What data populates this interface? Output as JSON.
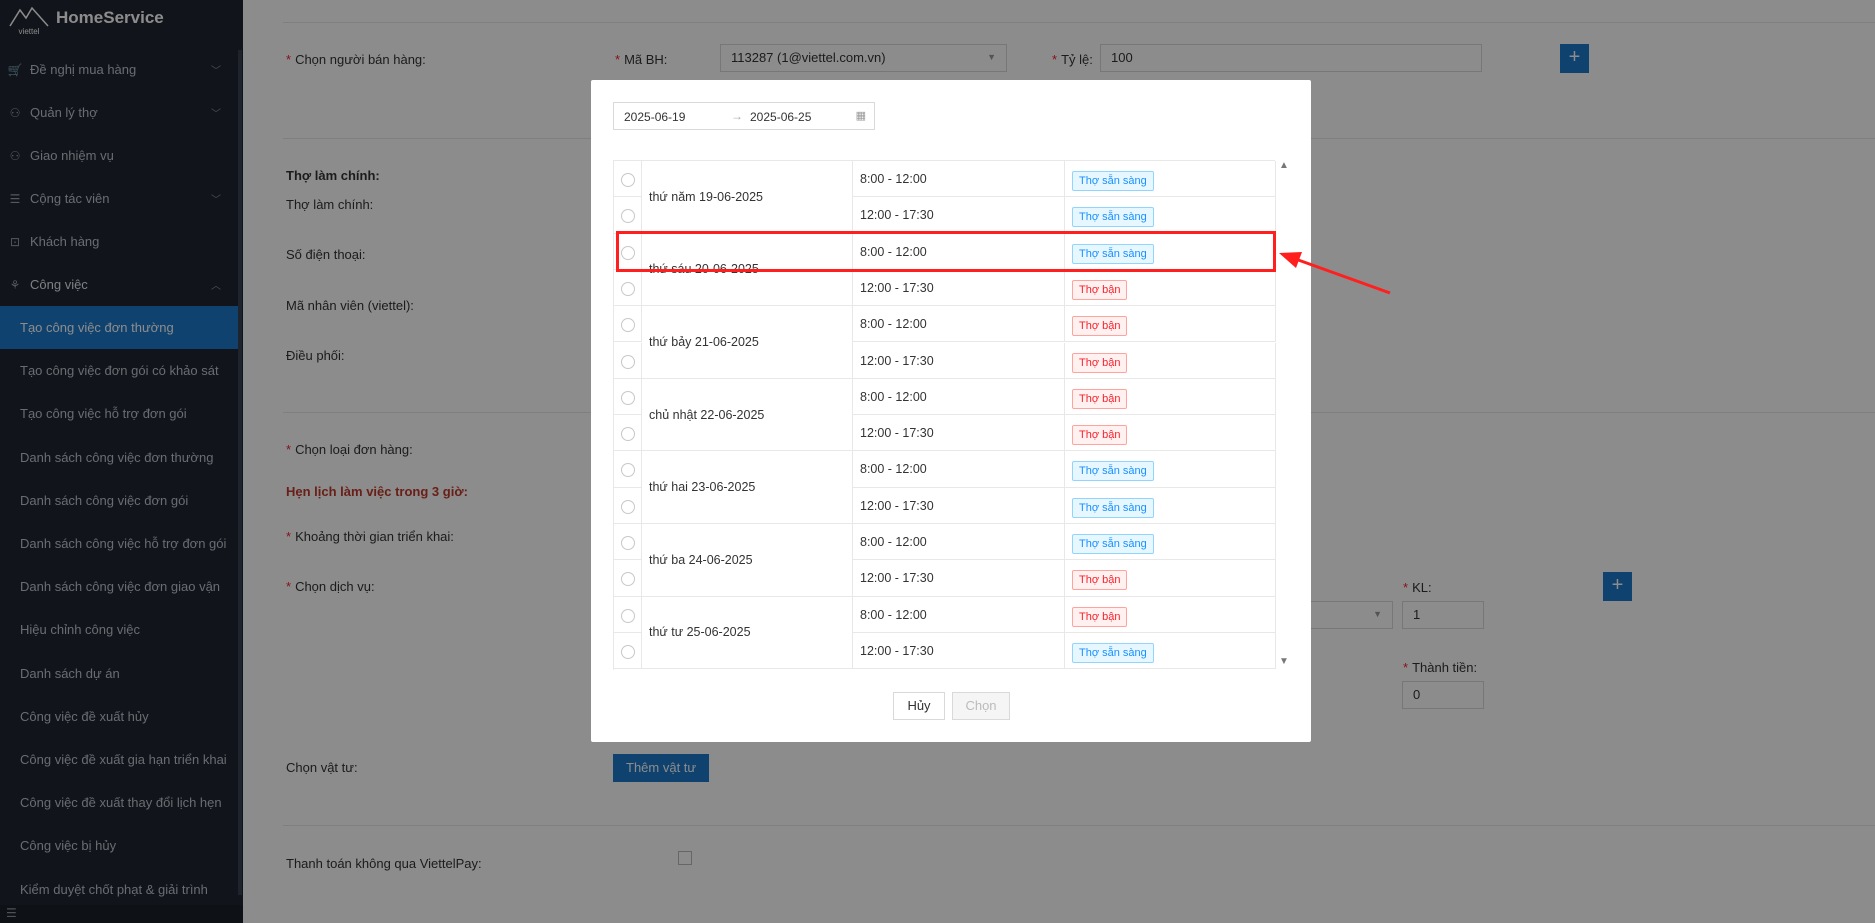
{
  "app": {
    "name": "HomeService",
    "logo_text": "viettel"
  },
  "sidebar": {
    "items": [
      {
        "label": "Đề nghị mua hàng",
        "icon": "cart-icon",
        "chevron": "down"
      },
      {
        "label": "Quản lý thợ",
        "icon": "user-icon",
        "chevron": "down"
      },
      {
        "label": "Giao nhiệm vụ",
        "icon": "user-icon",
        "chevron": ""
      },
      {
        "label": "Cộng tác viên",
        "icon": "list-icon",
        "chevron": "down"
      },
      {
        "label": "Khách hàng",
        "icon": "user-card-icon",
        "chevron": ""
      },
      {
        "label": "Công việc",
        "icon": "cluster-icon",
        "chevron": "up"
      }
    ],
    "subitems": [
      "Tạo công việc đơn thường",
      "Tạo công việc đơn gói có khảo sát",
      "Tạo công việc hỗ trợ đơn gói",
      "Danh sách công việc đơn thường",
      "Danh sách công việc đơn gói",
      "Danh sách công việc hỗ trợ đơn gói",
      "Danh sách công việc đơn giao vận",
      "Hiệu chỉnh công việc",
      "Danh sách dự án",
      "Công việc đề xuất hủy",
      "Công việc đề xuất gia hạn triển khai",
      "Công việc đề xuất thay đổi lịch hẹn",
      "Công việc bị hủy",
      "Kiểm duyệt chốt phạt & giải trình"
    ],
    "active_subitem": "Tạo công việc đơn thường"
  },
  "form": {
    "seller_label": "Chọn người bán hàng:",
    "ma_bh_label": "Mã BH:",
    "ma_bh_value": "113287 (1@viettel.com.vn)",
    "ty_le_label": "Tỷ lệ:",
    "ty_le_value": "100",
    "tho_lam_chinh_heading": "Thợ làm chính:",
    "tho_lam_chinh_label": "Thợ làm chính:",
    "so_dien_thoai_label": "Số điện thoại:",
    "ma_nhan_vien_label": "Mã nhân viên (viettel):",
    "dieu_phoi_label": "Điều phối:",
    "loai_don_hang_label": "Chọn loại đơn hàng:",
    "hen_lich_label": "Hẹn lịch làm việc trong 3 giờ:",
    "khoang_thoi_gian_label": "Khoảng thời gian triển khai:",
    "dich_vu_label": "Chọn dịch vụ:",
    "kl_label": "KL:",
    "kl_value": "1",
    "thanh_tien_label": "Thành tiền:",
    "thanh_tien_value": "0",
    "vat_tu_label": "Chọn vật tư:",
    "them_vat_tu_label": "Thêm vật tư",
    "thanh_toan_label": "Thanh toán không qua ViettelPay:"
  },
  "modal": {
    "date_from": "2025-06-19",
    "date_to": "2025-06-25",
    "date_separator": "→",
    "days": [
      {
        "label": "thứ năm 19-06-2025",
        "slots": [
          {
            "time": "8:00 - 12:00",
            "status": "Thợ sẵn sàng",
            "available": true
          },
          {
            "time": "12:00 - 17:30",
            "status": "Thợ sẵn sàng",
            "available": true
          }
        ]
      },
      {
        "label": "thứ sáu 20-06-2025",
        "slots": [
          {
            "time": "8:00 - 12:00",
            "status": "Thợ sẵn sàng",
            "available": true
          },
          {
            "time": "12:00 - 17:30",
            "status": "Thợ bận",
            "available": false
          }
        ]
      },
      {
        "label": "thứ bảy 21-06-2025",
        "slots": [
          {
            "time": "8:00 - 12:00",
            "status": "Thợ bận",
            "available": false
          },
          {
            "time": "12:00 - 17:30",
            "status": "Thợ bận",
            "available": false
          }
        ]
      },
      {
        "label": "chủ nhật 22-06-2025",
        "slots": [
          {
            "time": "8:00 - 12:00",
            "status": "Thợ bận",
            "available": false
          },
          {
            "time": "12:00 - 17:30",
            "status": "Thợ bận",
            "available": false
          }
        ]
      },
      {
        "label": "thứ hai 23-06-2025",
        "slots": [
          {
            "time": "8:00 - 12:00",
            "status": "Thợ sẵn sàng",
            "available": true
          },
          {
            "time": "12:00 - 17:30",
            "status": "Thợ sẵn sàng",
            "available": true
          }
        ]
      },
      {
        "label": "thứ ba 24-06-2025",
        "slots": [
          {
            "time": "8:00 - 12:00",
            "status": "Thợ sẵn sàng",
            "available": true
          },
          {
            "time": "12:00 - 17:30",
            "status": "Thợ bận",
            "available": false
          }
        ]
      },
      {
        "label": "thứ tư 25-06-2025",
        "slots": [
          {
            "time": "8:00 - 12:00",
            "status": "Thợ bận",
            "available": false
          },
          {
            "time": "12:00 - 17:30",
            "status": "Thợ sẵn sàng",
            "available": true
          }
        ]
      }
    ],
    "cancel_label": "Hủy",
    "choose_label": "Chọn"
  },
  "colors": {
    "sidebar_bg": "#1f2530",
    "accent": "#1d78c9",
    "annotation": "#ff1f1f"
  }
}
